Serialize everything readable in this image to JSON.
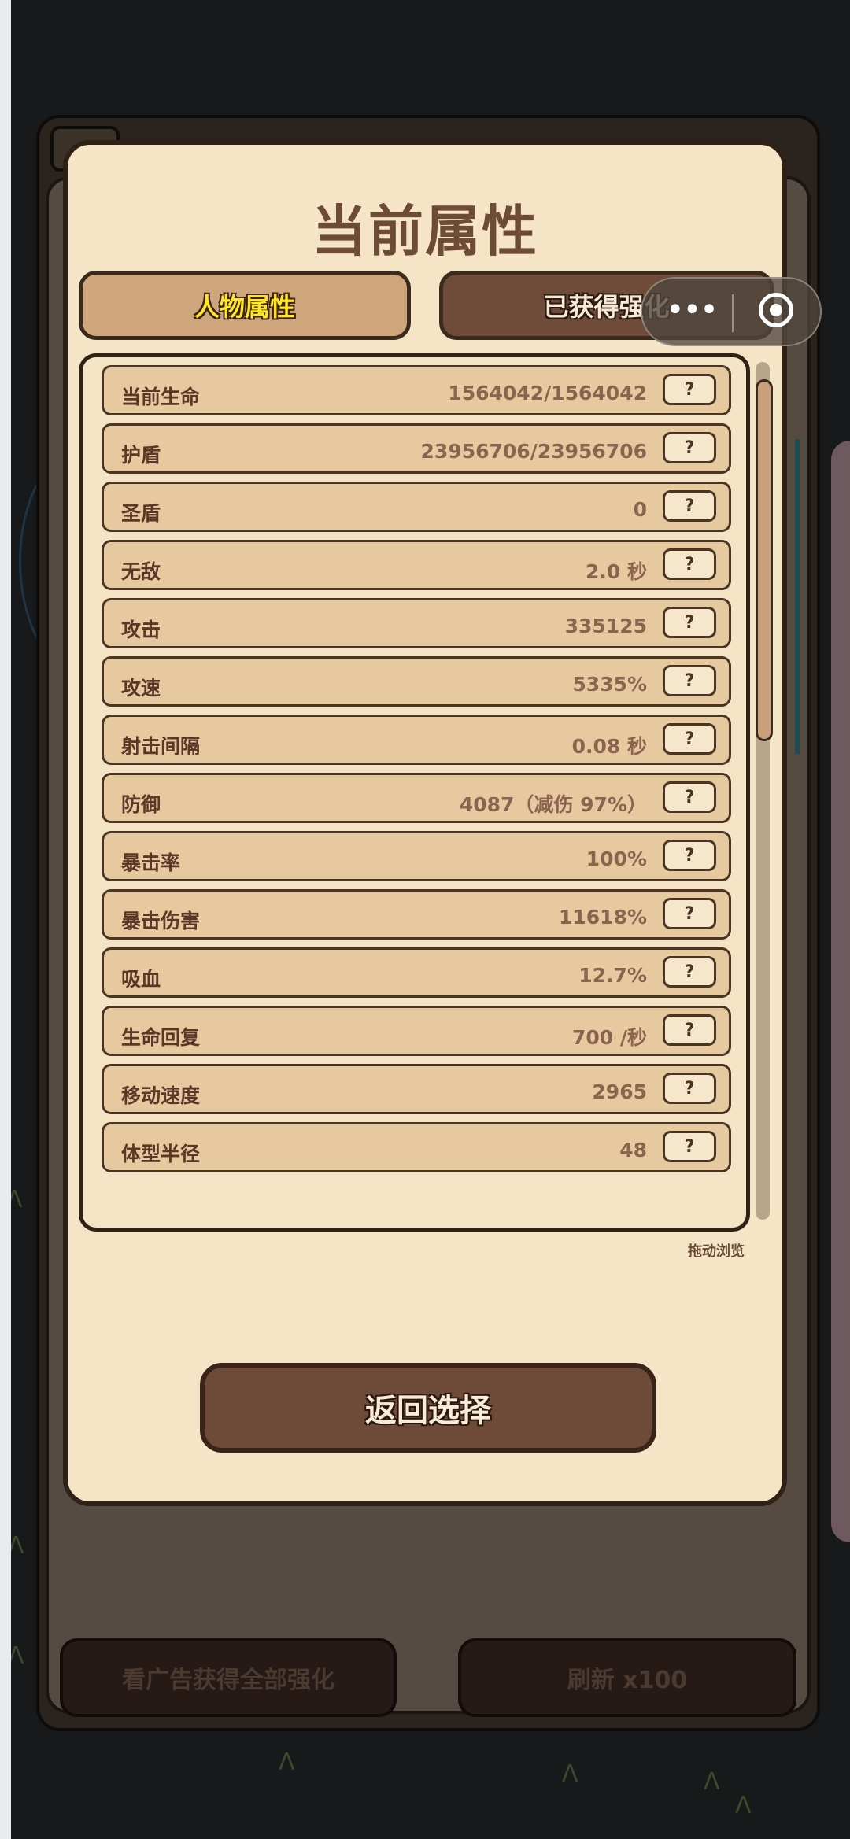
{
  "modal": {
    "title": "当前属性",
    "tabs": [
      {
        "label": "人物属性",
        "active": true
      },
      {
        "label": "已获得强化",
        "active": false
      }
    ],
    "stats": [
      {
        "label": "当前生命",
        "value": "1564042/1564042"
      },
      {
        "label": "护盾",
        "value": "23956706/23956706"
      },
      {
        "label": "圣盾",
        "value": "0"
      },
      {
        "label": "无敌",
        "value": "2.0 秒"
      },
      {
        "label": "攻击",
        "value": "335125"
      },
      {
        "label": "攻速",
        "value": "5335%"
      },
      {
        "label": "射击间隔",
        "value": "0.08 秒"
      },
      {
        "label": "防御",
        "value": "4087（减伤 97%）"
      },
      {
        "label": "暴击率",
        "value": "100%"
      },
      {
        "label": "暴击伤害",
        "value": "11618%"
      },
      {
        "label": "吸血",
        "value": "12.7%"
      },
      {
        "label": "生命回复",
        "value": "700 /秒"
      },
      {
        "label": "移动速度",
        "value": "2965"
      },
      {
        "label": "体型半径",
        "value": "48"
      }
    ],
    "help_label": "?",
    "drag_hint": "拖动浏览",
    "return_label": "返回选择"
  },
  "background": {
    "ad_button": "看广告获得全部强化",
    "refresh_button": "刷新 x100"
  },
  "capsule": {
    "more_icon": "more-dots-icon",
    "close_icon": "record-circle-icon"
  },
  "colors": {
    "panel": "#f5e5c6",
    "row": "#e7c9a0",
    "active_tab_text": "#ffe628",
    "button": "#6e4a39"
  }
}
